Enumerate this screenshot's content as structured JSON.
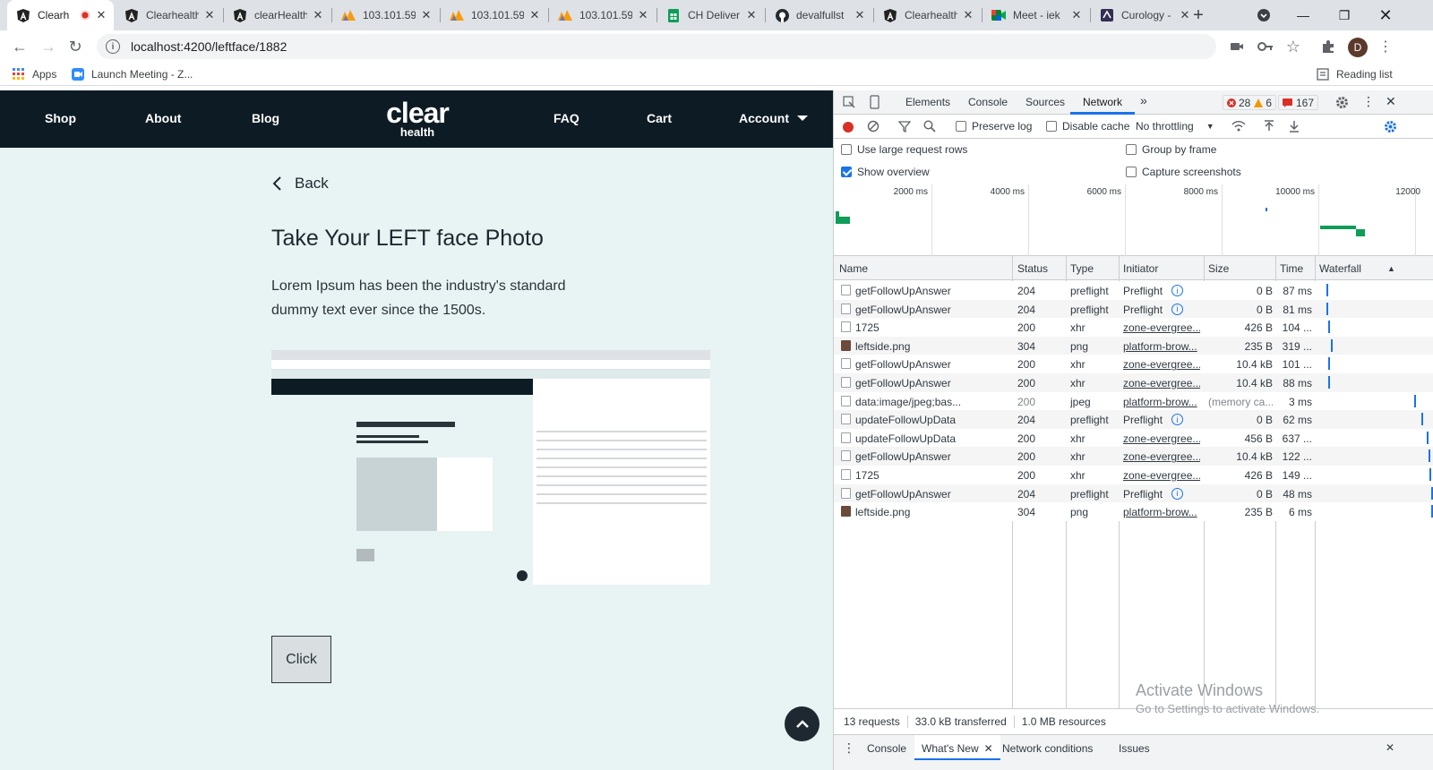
{
  "browser": {
    "tabs": [
      {
        "title": "Clearh",
        "icon": "angular-icon",
        "active": true,
        "recording": true
      },
      {
        "title": "Clearhealth",
        "icon": "angular-icon"
      },
      {
        "title": "clearHealth",
        "icon": "angular-icon"
      },
      {
        "title": "103.101.59",
        "icon": "phpmyadmin-icon"
      },
      {
        "title": "103.101.59",
        "icon": "phpmyadmin-icon"
      },
      {
        "title": "103.101.59",
        "icon": "phpmyadmin-icon"
      },
      {
        "title": "CH Deliver",
        "icon": "sheets-icon"
      },
      {
        "title": "devalfullst",
        "icon": "github-icon"
      },
      {
        "title": "Clearhealth",
        "icon": "angular-icon"
      },
      {
        "title": "Meet - iek",
        "icon": "meet-icon"
      },
      {
        "title": "Curology -",
        "icon": "curology-icon"
      }
    ],
    "url": "localhost:4200/leftface/1882",
    "bookmarks": {
      "apps": "Apps",
      "meeting": "Launch Meeting - Z..."
    },
    "reading_list": "Reading list",
    "avatar_letter": "D"
  },
  "site": {
    "nav": {
      "shop": "Shop",
      "about": "About",
      "blog": "Blog",
      "faq": "FAQ",
      "cart": "Cart",
      "account": "Account"
    },
    "logo": {
      "line1": "clear",
      "line2": "health"
    },
    "back": "Back",
    "title": "Take Your LEFT face Photo",
    "description": "Lorem Ipsum has been the industry's standard dummy text ever since the 1500s.",
    "button": "Click"
  },
  "devtools": {
    "tabs": {
      "elements": "Elements",
      "console": "Console",
      "sources": "Sources",
      "network": "Network"
    },
    "errors": "28",
    "warnings": "6",
    "issues": "167",
    "toolbar": {
      "preserve_log": "Preserve log",
      "disable_cache": "Disable cache",
      "throttling": "No throttling"
    },
    "options": {
      "large_rows": "Use large request rows",
      "show_overview": "Show overview",
      "group_by_frame": "Group by frame",
      "capture_screenshots": "Capture screenshots"
    },
    "overview_ticks": [
      "2000 ms",
      "4000 ms",
      "6000 ms",
      "8000 ms",
      "10000 ms",
      "12000"
    ],
    "columns": {
      "name": "Name",
      "status": "Status",
      "type": "Type",
      "initiator": "Initiator",
      "size": "Size",
      "time": "Time",
      "waterfall": "Waterfall"
    },
    "requests": [
      {
        "name": "getFollowUpAnswer",
        "status": "204",
        "type": "preflight",
        "initiator": "Preflight",
        "init_link": false,
        "size": "0 B",
        "time": "87 ms",
        "wf": 0.08,
        "img": false
      },
      {
        "name": "getFollowUpAnswer",
        "status": "204",
        "type": "preflight",
        "initiator": "Preflight",
        "init_link": false,
        "size": "0 B",
        "time": "81 ms",
        "wf": 0.08,
        "img": false
      },
      {
        "name": "1725",
        "status": "200",
        "type": "xhr",
        "initiator": "zone-evergree...",
        "init_link": true,
        "size": "426 B",
        "time": "104 ...",
        "wf": 0.09,
        "img": false
      },
      {
        "name": "leftside.png",
        "status": "304",
        "type": "png",
        "initiator": "platform-brow...",
        "init_link": true,
        "size": "235 B",
        "time": "319 ...",
        "wf": 0.12,
        "img": true
      },
      {
        "name": "getFollowUpAnswer",
        "status": "200",
        "type": "xhr",
        "initiator": "zone-evergree...",
        "init_link": true,
        "size": "10.4 kB",
        "time": "101 ...",
        "wf": 0.09,
        "img": false
      },
      {
        "name": "getFollowUpAnswer",
        "status": "200",
        "type": "xhr",
        "initiator": "zone-evergree...",
        "init_link": true,
        "size": "10.4 kB",
        "time": "88 ms",
        "wf": 0.09,
        "img": false
      },
      {
        "name": "data:image/jpeg;bas...",
        "status": "200",
        "type": "jpeg",
        "initiator": "platform-brow...",
        "init_link": true,
        "size": "(memory ca...",
        "time": "3 ms",
        "wf": 0.84,
        "img": false,
        "dim": true
      },
      {
        "name": "updateFollowUpData",
        "status": "204",
        "type": "preflight",
        "initiator": "Preflight",
        "init_link": false,
        "size": "0 B",
        "time": "62 ms",
        "wf": 0.91,
        "img": false
      },
      {
        "name": "updateFollowUpData",
        "status": "200",
        "type": "xhr",
        "initiator": "zone-evergree...",
        "init_link": true,
        "size": "456 B",
        "time": "637 ...",
        "wf": 0.95,
        "img": false
      },
      {
        "name": "getFollowUpAnswer",
        "status": "200",
        "type": "xhr",
        "initiator": "zone-evergree...",
        "init_link": true,
        "size": "10.4 kB",
        "time": "122 ...",
        "wf": 0.97,
        "img": false
      },
      {
        "name": "1725",
        "status": "200",
        "type": "xhr",
        "initiator": "zone-evergree...",
        "init_link": true,
        "size": "426 B",
        "time": "149 ...",
        "wf": 0.98,
        "img": false
      },
      {
        "name": "getFollowUpAnswer",
        "status": "204",
        "type": "preflight",
        "initiator": "Preflight",
        "init_link": false,
        "size": "0 B",
        "time": "48 ms",
        "wf": 0.99,
        "img": false
      },
      {
        "name": "leftside.png",
        "status": "304",
        "type": "png",
        "initiator": "platform-brow...",
        "init_link": true,
        "size": "235 B",
        "time": "6 ms",
        "wf": 0.99,
        "img": true
      }
    ],
    "status_bar": {
      "requests": "13 requests",
      "transferred": "33.0 kB transferred",
      "resources": "1.0 MB resources"
    },
    "drawer": {
      "console": "Console",
      "whats_new": "What's New",
      "network_conditions": "Network conditions",
      "issues": "Issues"
    }
  },
  "watermark": {
    "line1": "Activate Windows",
    "line2": "Go to Settings to activate Windows."
  },
  "colors": {
    "site_nav": "#0d1b24",
    "page_bg": "#e8f3f3",
    "devtools_accent": "#1a73e8",
    "record": "#d93025"
  }
}
